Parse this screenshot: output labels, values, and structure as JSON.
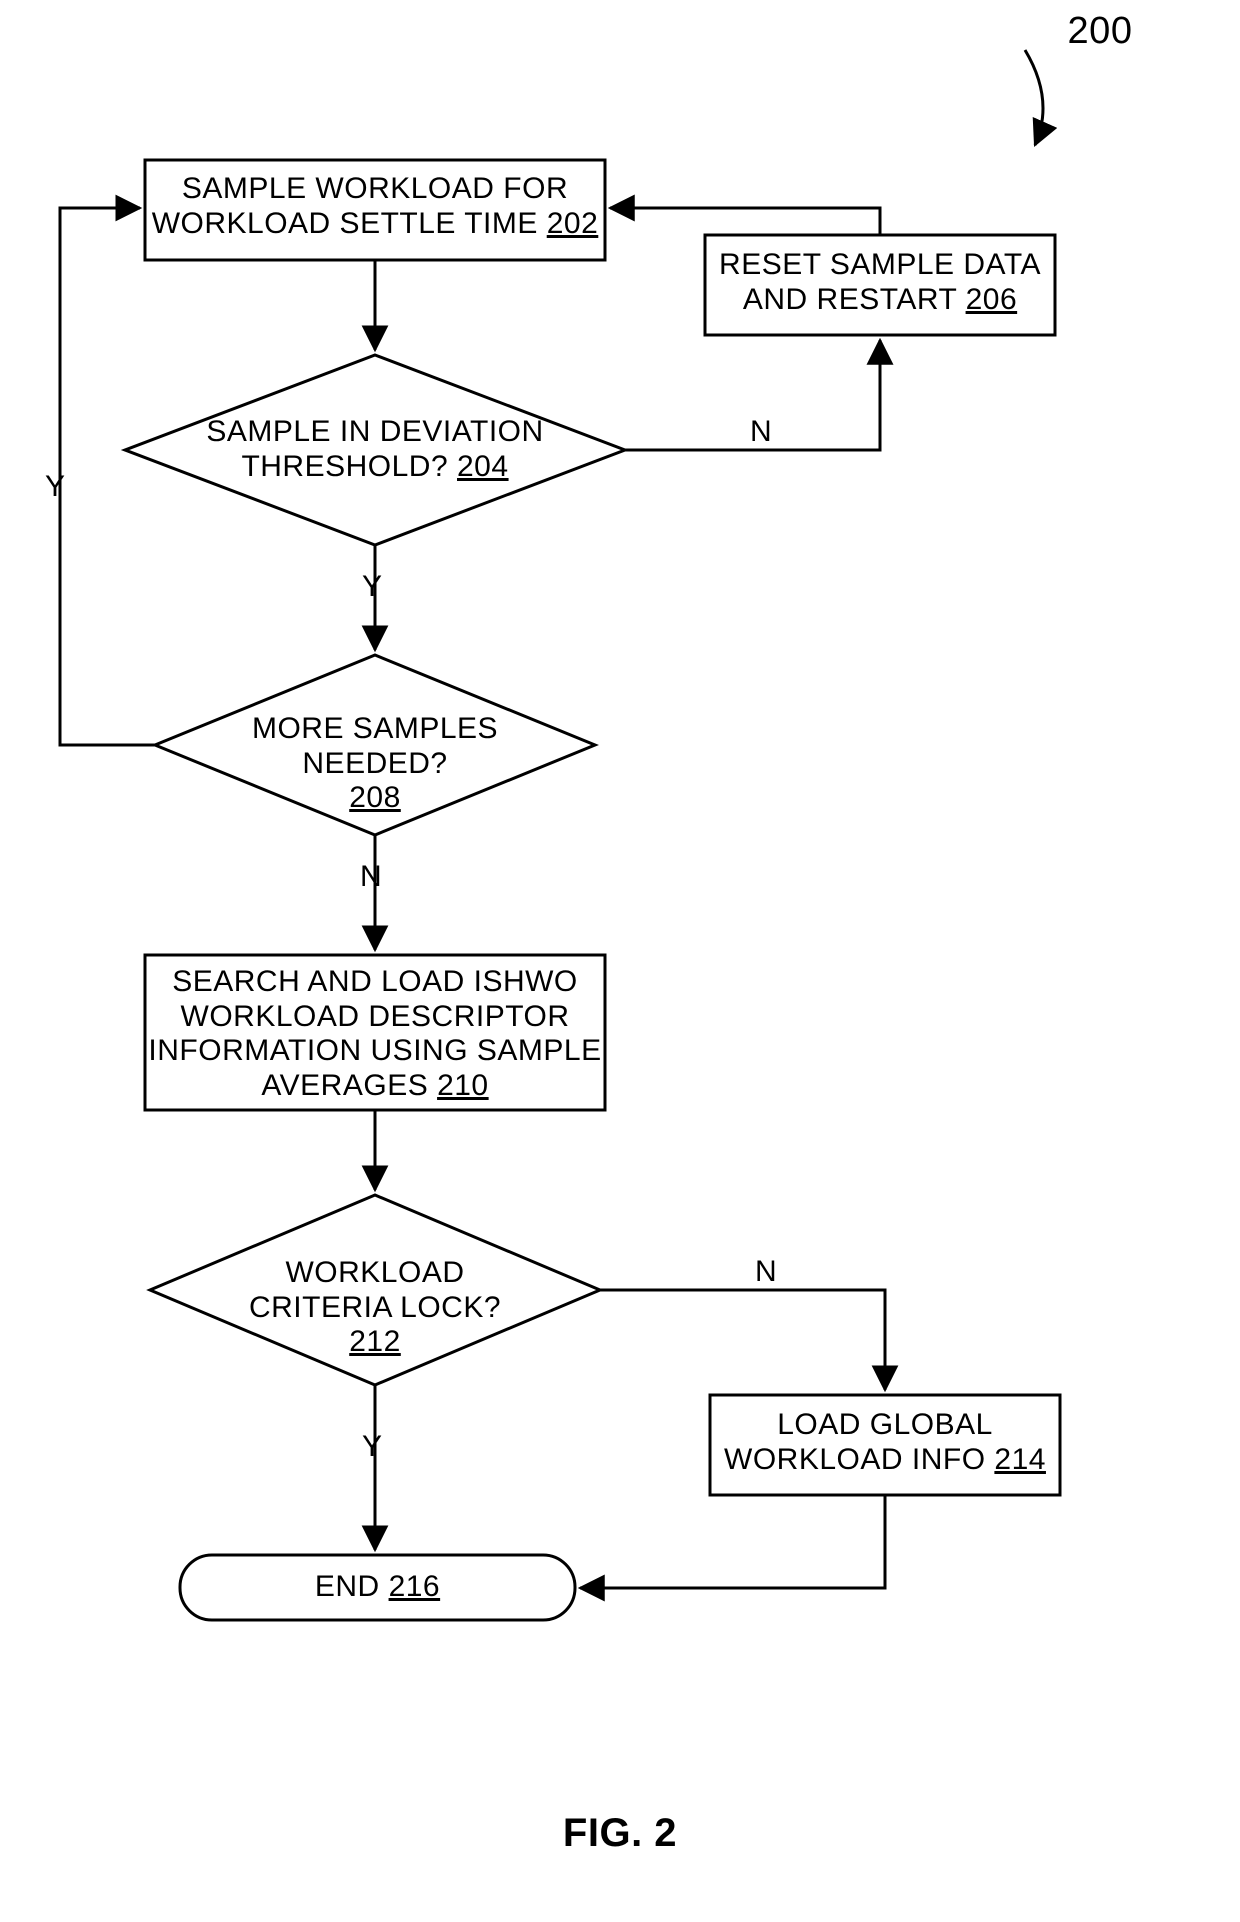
{
  "figure_number": "200",
  "figure_caption": "FIG. 2",
  "nodes": {
    "n202": {
      "text": "SAMPLE WORKLOAD FOR WORKLOAD SETTLE TIME",
      "ref": "202"
    },
    "n204": {
      "text": "SAMPLE IN DEVIATION THRESHOLD?",
      "ref": "204"
    },
    "n206": {
      "text": "RESET SAMPLE DATA AND RESTART",
      "ref": "206"
    },
    "n208": {
      "text": "MORE SAMPLES NEEDED?",
      "ref": "208"
    },
    "n210": {
      "text": "SEARCH AND LOAD ISHWO WORKLOAD DESCRIPTOR INFORMATION USING SAMPLE AVERAGES",
      "ref": "210"
    },
    "n212": {
      "text": "WORKLOAD CRITERIA LOCK?",
      "ref": "212"
    },
    "n214": {
      "text": "LOAD GLOBAL WORKLOAD INFO",
      "ref": "214"
    },
    "n216": {
      "text": "END",
      "ref": "216"
    }
  },
  "edge_labels": {
    "yes": "Y",
    "no": "N"
  }
}
